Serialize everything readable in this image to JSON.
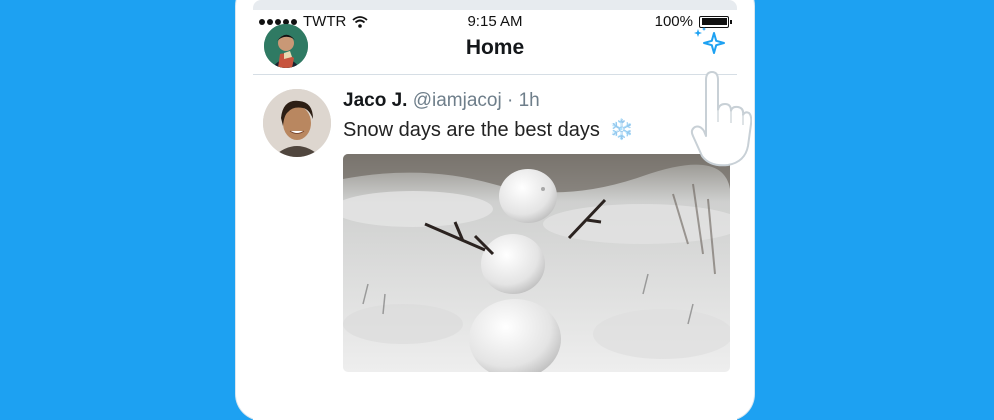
{
  "status_bar": {
    "carrier": "TWTR",
    "time": "9:15 AM",
    "battery": "100%",
    "icons": [
      "signal-dots-icon",
      "wifi-icon",
      "battery-icon"
    ]
  },
  "nav": {
    "title": "Home",
    "icons": [
      "profile-avatar",
      "sparkle-icon"
    ]
  },
  "tweet": {
    "author": "Jaco J.",
    "handle": "@iamjacoj",
    "separator": " · ",
    "time": "1h",
    "text": "Snow days are the best days",
    "emoji": "❄️",
    "media": "snowman-photo"
  },
  "colors": {
    "background": "#1da1f2",
    "accent": "#1da1f2",
    "text": "#14171a",
    "secondary_text": "#6e7e8a"
  }
}
